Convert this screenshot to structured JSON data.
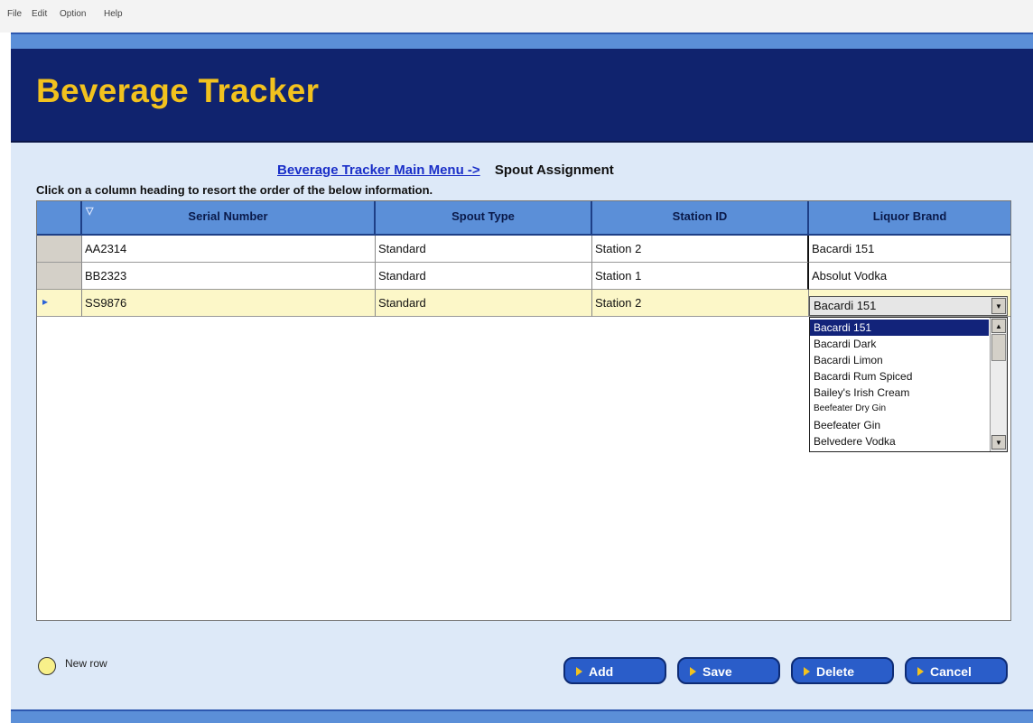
{
  "menu": [
    "File",
    "Edit",
    "Option",
    "Help"
  ],
  "app": {
    "title": "Beverage Tracker"
  },
  "breadcrumb": {
    "link": "Beverage Tracker Main Menu ->",
    "current": "Spout Assignment"
  },
  "instructions": "Click on a column heading to resort the order of the below information.",
  "grid": {
    "sort_indicator": "▽",
    "columns": [
      "Serial Number",
      "Spout Type",
      "Station ID",
      "Liquor Brand"
    ],
    "rows": [
      [
        "AA2314",
        "Standard",
        "Station 2",
        "Bacardi 151"
      ],
      [
        "BB2323",
        "Standard",
        "Station 1",
        "Absolut Vodka"
      ],
      [
        "SS9876",
        "Standard",
        "Station 2",
        "Bacardi 151"
      ]
    ],
    "current_row_marker": "▸"
  },
  "dropdown": {
    "value": "Bacardi 151",
    "options": [
      "Bacardi 151",
      "Bacardi Dark",
      "Bacardi Limon",
      "Bacardi Rum Spiced",
      "Bailey's Irish Cream",
      "Beefeater Dry Gin",
      "Beefeater Gin",
      "Belvedere Vodka"
    ],
    "selected_index": 0
  },
  "legend": {
    "new_row": "New row"
  },
  "buttons": {
    "add": "Add",
    "save": "Save",
    "delete": "Delete",
    "cancel": "Cancel"
  },
  "colors": {
    "header": "#10236e",
    "title": "#f2c21e",
    "accent": "#5b8fd8",
    "current_row": "#fcf7c8"
  }
}
